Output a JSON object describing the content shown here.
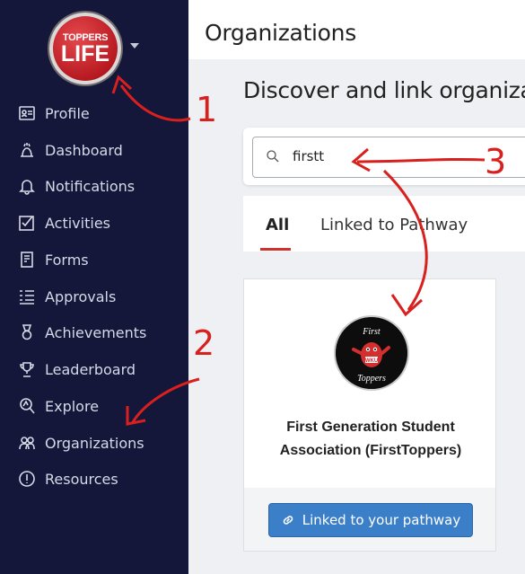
{
  "brand": {
    "logo_line1": "TOPPERS",
    "logo_line2": "LIFE",
    "accent_color": "#d0312d",
    "sidebar_color": "#14163a",
    "button_color": "#3a7fc8"
  },
  "sidebar": {
    "items": [
      {
        "label": "Profile",
        "icon": "profile-icon"
      },
      {
        "label": "Dashboard",
        "icon": "dashboard-icon"
      },
      {
        "label": "Notifications",
        "icon": "bell-icon"
      },
      {
        "label": "Activities",
        "icon": "checkbox-icon"
      },
      {
        "label": "Forms",
        "icon": "form-icon"
      },
      {
        "label": "Approvals",
        "icon": "list-check-icon"
      },
      {
        "label": "Achievements",
        "icon": "medal-icon"
      },
      {
        "label": "Leaderboard",
        "icon": "trophy-icon"
      },
      {
        "label": "Explore",
        "icon": "explore-icon"
      },
      {
        "label": "Organizations",
        "icon": "people-icon"
      },
      {
        "label": "Resources",
        "icon": "info-icon"
      }
    ]
  },
  "header": {
    "title": "Organizations"
  },
  "main": {
    "heading": "Discover and link organiza",
    "search": {
      "value": "firstt",
      "icon": "search-icon"
    },
    "tabs": [
      {
        "label": "All",
        "active": true
      },
      {
        "label": "Linked to Pathway",
        "active": false
      }
    ],
    "org_card": {
      "logo_text_top": "First",
      "logo_text_bottom": "Toppers",
      "logo_badge": "WKU",
      "name_line1": "First Generation Student",
      "name_line2": "Association (FirstToppers)",
      "button_label": "Linked to your pathway",
      "button_icon": "link-icon"
    }
  },
  "annotations": [
    "1",
    "2",
    "3"
  ]
}
